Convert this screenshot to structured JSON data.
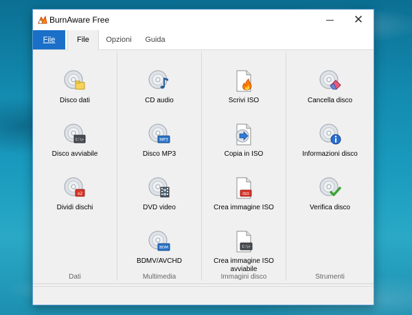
{
  "window": {
    "title": "BurnAware Free"
  },
  "tabs": {
    "file_menu": "File",
    "file": "File",
    "options": "Opzioni",
    "guide": "Guida"
  },
  "groups": [
    {
      "label": "Dati",
      "items": [
        "Disco dati",
        "Disco avviabile",
        "Dividi dischi"
      ]
    },
    {
      "label": "Multimedia",
      "items": [
        "CD audio",
        "Disco MP3",
        "DVD video",
        "BDMV/AVCHD"
      ]
    },
    {
      "label": "Immagini disco",
      "items": [
        "Scrivi ISO",
        "Copia in ISO",
        "Crea immagine ISO",
        "Crea immagine ISO avviabile"
      ]
    },
    {
      "label": "Strumenti",
      "items": [
        "Cancella disco",
        "Informazioni disco",
        "Verifica disco"
      ]
    }
  ],
  "icons": {
    "badges": {
      "boot": "C:\\>",
      "mp3": "MP3",
      "bdm": "BDM",
      "iso": "ISO",
      "split": "x2"
    }
  },
  "colors": {
    "accent": "#1a6fc9",
    "window_border": "#5a9bd5"
  }
}
